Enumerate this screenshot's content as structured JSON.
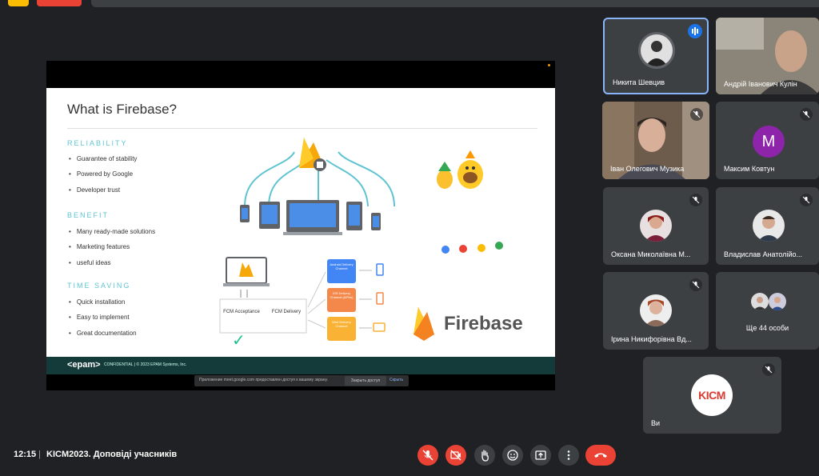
{
  "meeting": {
    "time": "12:15",
    "separator": "|",
    "title": "KICM2023. Доповіді учасників"
  },
  "slide": {
    "title": "What is Firebase?",
    "sections": [
      {
        "heading": "RELIABILITY",
        "items": [
          "Guarantee of stability",
          "Powered by Google",
          "Developer trust"
        ]
      },
      {
        "heading": "BENEFIT",
        "items": [
          "Many ready-made solutions",
          "Marketing features",
          "useful ideas"
        ]
      },
      {
        "heading": "TIME SAVING",
        "items": [
          "Quick installation",
          "Easy to implement",
          "Great documentation"
        ]
      }
    ],
    "diagram": {
      "fcm_acceptance": "FCM Acceptance",
      "fcm_delivery": "FCM Delivery",
      "android": "Android Delivery Channel",
      "ios": "iOS Delivery Channel (APNs)",
      "web": "Web Delivery Channel"
    },
    "brand": "Firebase",
    "footer_logo": "<epam>",
    "footer_text": "CONFIDENTIAL | © 2023 EPAM Systems, Inc."
  },
  "share_bar": {
    "text": "Приложение meet.google.com предоставлен доступ к вашему экрану.",
    "stop": "Закрыть доступ",
    "hide": "Скрыть"
  },
  "participants": [
    {
      "name": "Никита Шевцив"
    },
    {
      "name": "Андрій Іванович Кулін"
    },
    {
      "name": "Іван Олегович Музика"
    },
    {
      "name": "Максим Ковтун",
      "letter": "M"
    },
    {
      "name": "Оксана Миколаївна М..."
    },
    {
      "name": "Владислав Анатолійо..."
    },
    {
      "name": "Ірина Никифорівна Вд..."
    },
    {
      "name": "Ще 44 особи"
    },
    {
      "name": "Ви",
      "logo": "KICM"
    }
  ],
  "colors": {
    "background": "#202124",
    "tile": "#3c4043",
    "danger": "#ea4335",
    "accent": "#8ab4f8"
  },
  "controls": [
    "mic-off-icon",
    "camera-off-icon",
    "raise-hand-icon",
    "emoji-icon",
    "present-icon",
    "more-icon",
    "hang-up-icon"
  ]
}
